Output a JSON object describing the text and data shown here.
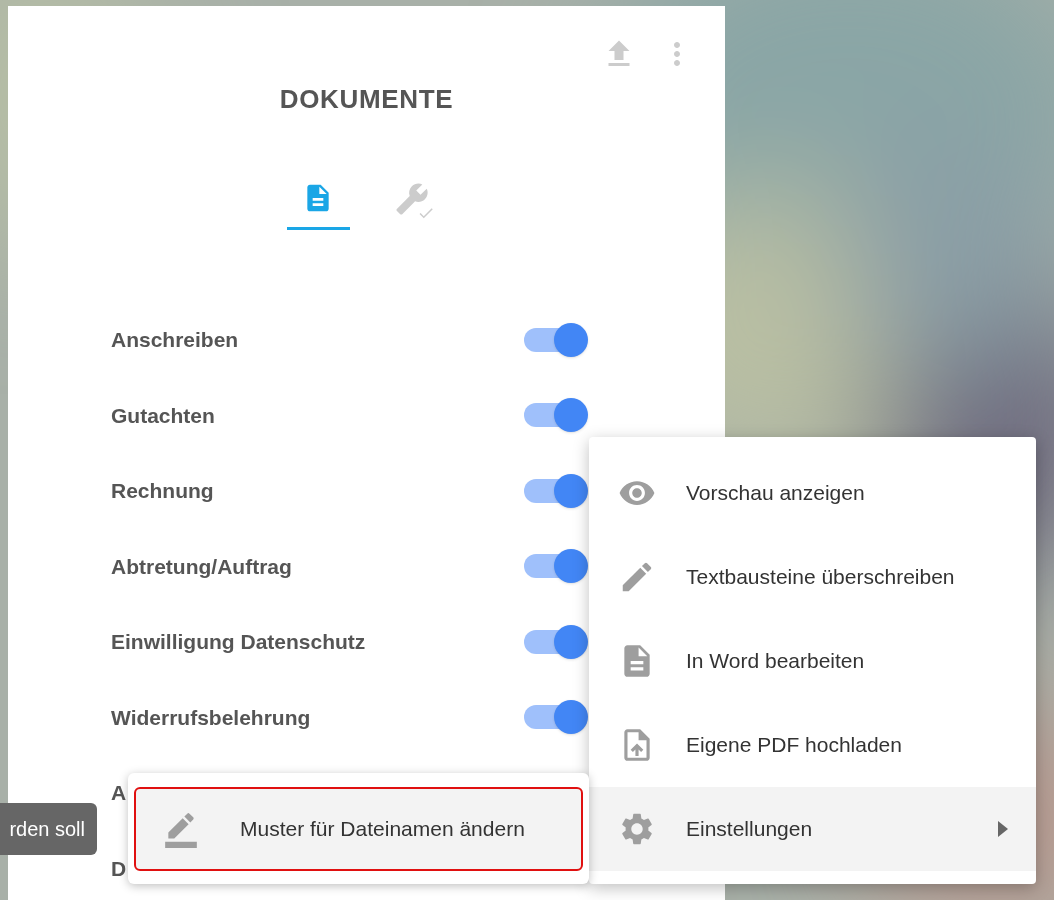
{
  "panel": {
    "title": "DOKUMENTE",
    "tabs": [
      {
        "kind": "document",
        "selected": true
      },
      {
        "kind": "wrench",
        "selected": false
      }
    ],
    "documents": [
      {
        "label": "Anschreiben",
        "on": true
      },
      {
        "label": "Gutachten",
        "on": true
      },
      {
        "label": "Rechnung",
        "on": true
      },
      {
        "label": "Abtretung/Auftrag",
        "on": true
      },
      {
        "label": "Einwilligung Datenschutz",
        "on": true
      },
      {
        "label": "Widerrufsbelehrung",
        "on": true
      },
      {
        "label": "A"
      },
      {
        "label": "D"
      }
    ]
  },
  "tooltip": {
    "text": "rden soll"
  },
  "context_menu": {
    "items": [
      {
        "kind": "eye",
        "label": "Vorschau anzeigen",
        "selected": false,
        "submenu": false
      },
      {
        "kind": "pencil",
        "label": "Textbausteine überschreiben",
        "selected": false,
        "submenu": false
      },
      {
        "kind": "document",
        "label": "In Word bearbeiten",
        "selected": false,
        "submenu": false
      },
      {
        "kind": "file-upload",
        "label": "Eigene PDF hochladen",
        "selected": false,
        "submenu": false
      },
      {
        "kind": "gear",
        "label": "Einstellungen",
        "selected": true,
        "submenu": true
      }
    ]
  },
  "submenu": {
    "items": [
      {
        "kind": "pen-line",
        "label": "Muster für Dateinamen ändern",
        "focused": true
      }
    ]
  }
}
